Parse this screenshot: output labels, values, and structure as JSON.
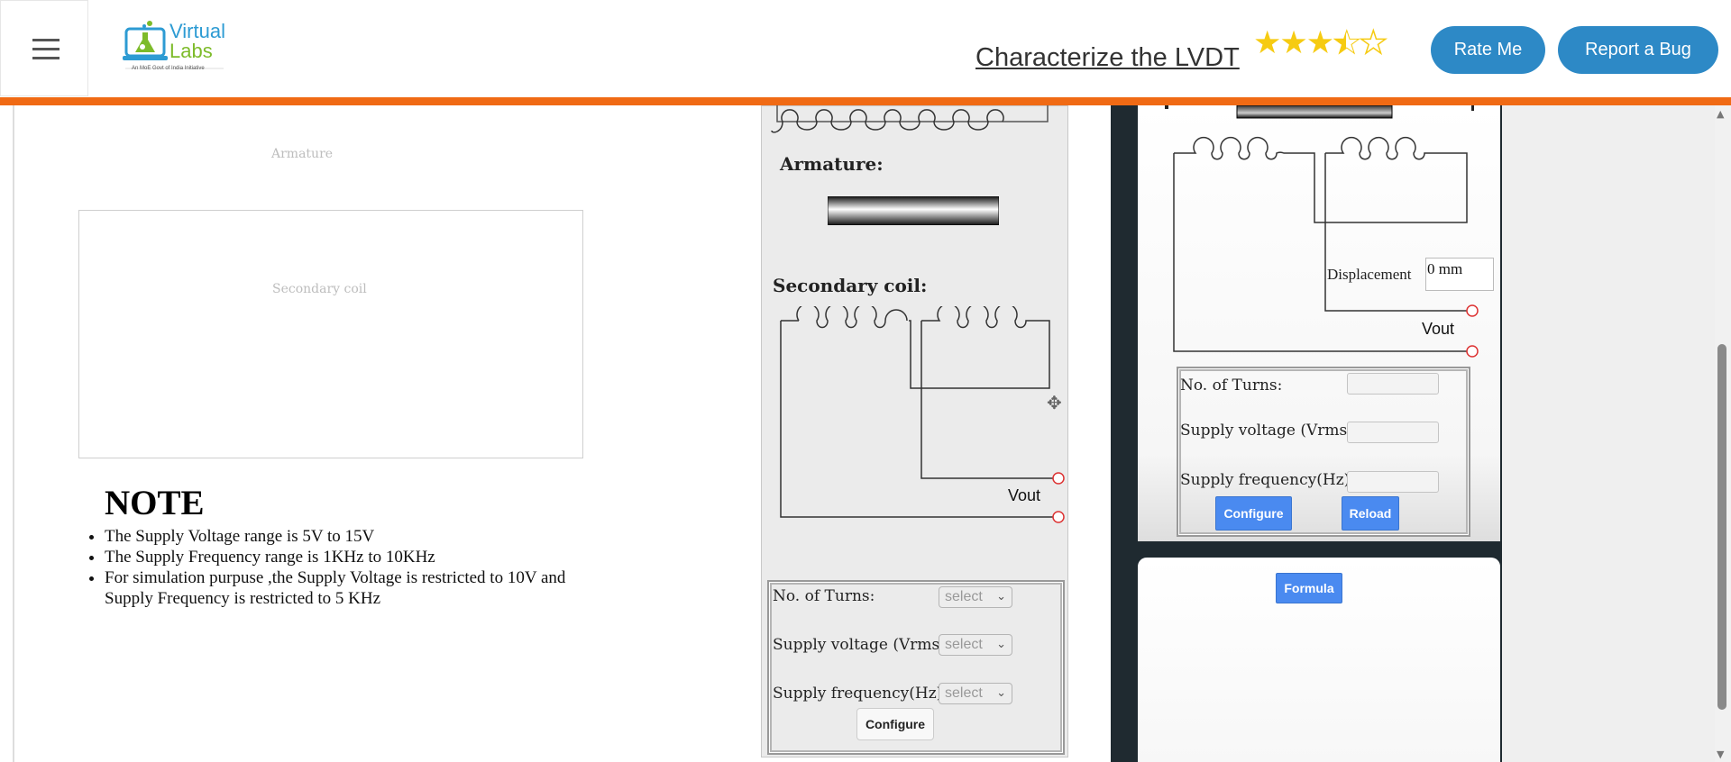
{
  "header": {
    "menu_icon": "hamburger-icon",
    "logo": {
      "line1": "Virtual",
      "line2": "Labs",
      "tagline": "An MoE Govt of India Initiative"
    },
    "title": "Characterize the LVDT",
    "rating": 3.5,
    "rating_max": 5,
    "rate_label": "Rate Me",
    "report_label": "Report a Bug",
    "brand_color": "#2d89c6",
    "accent_color": "#f06a14"
  },
  "left": {
    "armature_label": "Armature",
    "secondary_label": "Secondary coil",
    "note_heading": "NOTE",
    "notes": [
      "The Supply Voltage range is 5V to 15V",
      "The Supply Frequency range is 1KHz to 10KHz",
      "For simulation purpuse ,the Supply Voltage is restricted to 10V and Supply Frequency is restricted to 5 KHz"
    ]
  },
  "middle": {
    "armature_heading": "Armature:",
    "secondary_heading": "Secondary coil:",
    "vout": "Vout",
    "form": {
      "turns_label": "No. of Turns:",
      "voltage_label": "Supply voltage (Vrms):",
      "frequency_label": "Supply frequency(Hz):",
      "turns_value": "select",
      "voltage_value": "select",
      "frequency_value": "select",
      "configure_label": "Configure"
    },
    "move_icon": "move-cursor-icon"
  },
  "right": {
    "displacement_label": "Displacement",
    "displacement_value": "0 mm",
    "vout": "Vout",
    "form": {
      "turns_label": "No. of Turns:",
      "voltage_label": "Supply voltage (Vrms):",
      "frequency_label": "Supply frequency(Hz):",
      "configure_label": "Configure",
      "reload_label": "Reload"
    },
    "formula_label": "Formula",
    "button_color": "#4a8af0"
  }
}
